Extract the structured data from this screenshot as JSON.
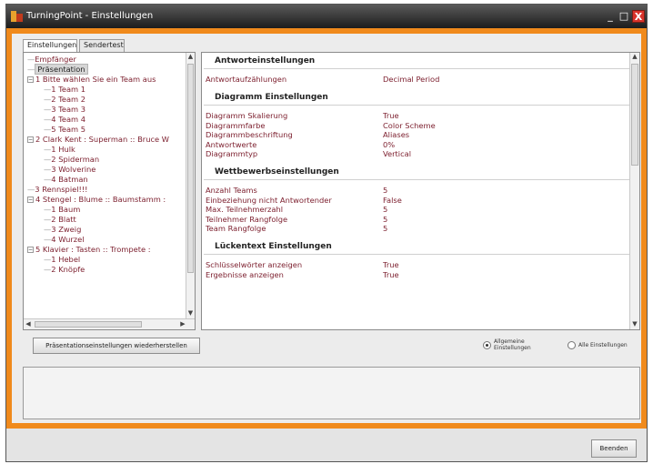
{
  "window": {
    "title": "TurningPoint - Einstellungen",
    "controls": {
      "minimize": "_",
      "maximize": "□",
      "close": "X"
    }
  },
  "tabs": [
    {
      "label": "Einstellungen",
      "active": true
    },
    {
      "label": "Sendertest",
      "active": false
    }
  ],
  "tree": {
    "items": [
      {
        "label": "Empfänger",
        "level": 0
      },
      {
        "label": "Präsentation",
        "level": 0,
        "selected": true
      },
      {
        "label": "1 Bitte wählen Sie ein Team aus",
        "level": 0,
        "expandable": true
      },
      {
        "label": "1 Team 1",
        "level": 1
      },
      {
        "label": "2 Team 2",
        "level": 1
      },
      {
        "label": "3 Team 3",
        "level": 1
      },
      {
        "label": "4 Team 4",
        "level": 1
      },
      {
        "label": "5 Team 5",
        "level": 1
      },
      {
        "label": "2 Clark Kent : Superman :: Bruce W",
        "level": 0,
        "expandable": true
      },
      {
        "label": "1 Hulk",
        "level": 1
      },
      {
        "label": "2 Spiderman",
        "level": 1
      },
      {
        "label": "3 Wolverine",
        "level": 1
      },
      {
        "label": "4 Batman",
        "level": 1
      },
      {
        "label": "3 Rennspiel!!!",
        "level": 0
      },
      {
        "label": "4 Stengel : Blume :: Baumstamm :",
        "level": 0,
        "expandable": true
      },
      {
        "label": "1 Baum",
        "level": 1
      },
      {
        "label": "2 Blatt",
        "level": 1
      },
      {
        "label": "3 Zweig",
        "level": 1
      },
      {
        "label": "4 Wurzel",
        "level": 1
      },
      {
        "label": "5 Klavier : Tasten :: Trompete :",
        "level": 0,
        "expandable": true
      },
      {
        "label": "1 Hebel",
        "level": 1
      },
      {
        "label": "2 Knöpfe",
        "level": 1
      }
    ]
  },
  "settings": {
    "sections": [
      {
        "title": "Antworteinstellungen",
        "rows": [
          {
            "label": "Antwortaufzählungen",
            "value": "Decimal Period"
          }
        ]
      },
      {
        "title": "Diagramm Einstellungen",
        "rows": [
          {
            "label": "Diagramm Skalierung",
            "value": "True"
          },
          {
            "label": "Diagrammfarbe",
            "value": "Color Scheme"
          },
          {
            "label": "Diagrammbeschriftung",
            "value": "Aliases"
          },
          {
            "label": "Antwortwerte",
            "value": "0%"
          },
          {
            "label": "Diagrammtyp",
            "value": "Vertical"
          }
        ]
      },
      {
        "title": "Wettbewerbseinstellungen",
        "rows": [
          {
            "label": "Anzahl Teams",
            "value": "5"
          },
          {
            "label": "Einbeziehung nicht Antwortender",
            "value": "False"
          },
          {
            "label": "Max. Teilnehmerzahl",
            "value": "5"
          },
          {
            "label": "Teilnehmer Rangfolge",
            "value": "5"
          },
          {
            "label": "Team Rangfolge",
            "value": "5"
          }
        ]
      },
      {
        "title": "Lückentext Einstellungen",
        "rows": [
          {
            "label": "Schlüsselwörter anzeigen",
            "value": "True"
          },
          {
            "label": "Ergebnisse anzeigen",
            "value": "True"
          }
        ]
      }
    ]
  },
  "restore_button": "Präsentationseinstellungen wiederherstellen",
  "radios": [
    {
      "label_line1": "Allgemeine",
      "label_line2": "Einstellungen",
      "checked": true
    },
    {
      "label_line1": "Alle Einstellungen",
      "label_line2": "",
      "checked": false
    }
  ],
  "end_button": "Beenden",
  "colors": {
    "accent_frame": "#f08a1c",
    "text_value": "#7b1d2c"
  }
}
